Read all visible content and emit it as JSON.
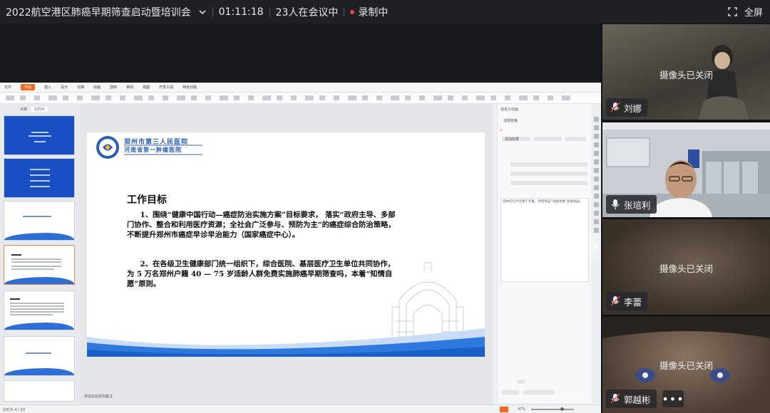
{
  "topbar": {
    "meeting_title": "2022航空港区肺癌早期筛查启动暨培训会",
    "timer": "01:11:18",
    "participants": "23人在会议中",
    "recording": "录制中",
    "fullscreen": "全屏"
  },
  "wps": {
    "tabs": [
      "文件",
      "开始",
      "插入",
      "设计",
      "切换",
      "动画",
      "放映",
      "审阅",
      "视图",
      "开发工具",
      "特色功能"
    ],
    "active_tab": "开始",
    "left_tabs": [
      "大纲",
      "幻灯片"
    ],
    "notes_placeholder": "单击此处添加备注",
    "status": "幻灯片 4 / 33",
    "zoom": "97%",
    "right_panel": {
      "header": "自定义动画",
      "option": "选择窗格",
      "action": "添加效果",
      "note": "选中幻灯片的某个元素，然后单击\"添加效果\"添加动画。"
    }
  },
  "slide": {
    "hospital_cn_1": "郑州市第三人民医院",
    "hospital_cn_2": "河南省第一肿瘤医院",
    "title": "工作目标",
    "paragraphs": [
      "1、围绕“健康中国行动—癌症防治实施方案”目标要求， 落实“政府主导、多部门协作、整合和利用医疗资源；全社会广泛参与、预防为主”的癌症综合防治策略，不断提升郑州市癌症早诊早治能力（国家癌症中心）。",
      "2、在各级卫生健康部门统一组织下，综合医院、基层医疗卫生单位共同协作， 为 5 万名郑州户籍 40 — 75 岁适龄人群免费实施肺癌早期筛查吗，本着“知情自愿”原则。"
    ]
  },
  "participants": [
    {
      "name": "刘娜",
      "status": "摄像头已关闭"
    },
    {
      "name": "张培利",
      "status": ""
    },
    {
      "name": "李蕾",
      "status": "摄像头已关闭"
    },
    {
      "name": "郭越彬",
      "status": "摄像头已关闭"
    }
  ],
  "more_label": "•••",
  "colors": {
    "accent": "#f06a20",
    "recording": "#e04545",
    "slide_blue": "#1a5ec8"
  }
}
